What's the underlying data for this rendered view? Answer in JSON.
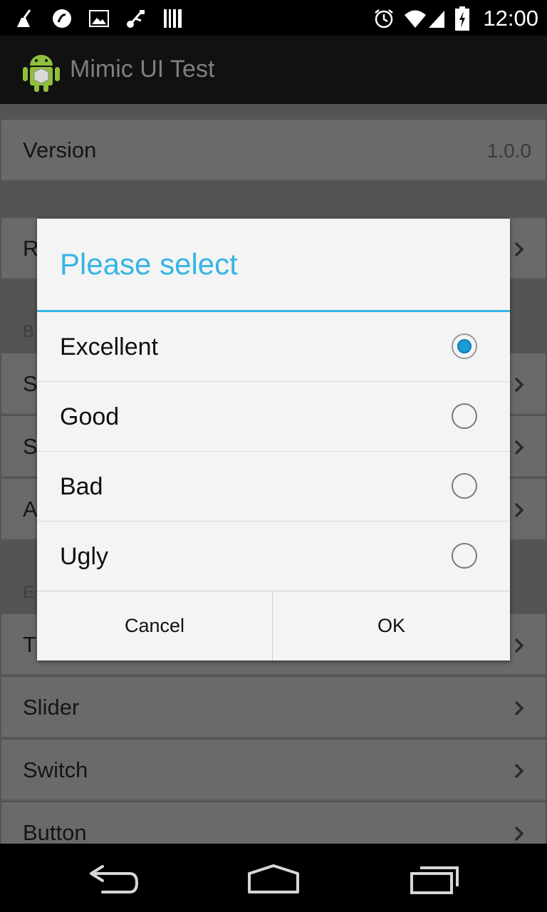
{
  "status_bar": {
    "time": "12:00",
    "left_icons": [
      "cleaner-icon",
      "sync-icon",
      "image-icon",
      "usb-icon",
      "barcode-icon"
    ],
    "right_icons": [
      "alarm-icon",
      "wifi-icon",
      "cell-signal-icon",
      "battery-icon"
    ]
  },
  "action_bar": {
    "title": "Mimic UI Test",
    "icon": "android-icon"
  },
  "background_list": {
    "rows": [
      {
        "label": "Version",
        "value": "1.0.0"
      },
      {
        "label": "R"
      },
      {
        "label": "S"
      },
      {
        "label": "S"
      },
      {
        "label": "A"
      },
      {
        "label": "T"
      },
      {
        "label": "Slider"
      },
      {
        "label": "Switch"
      },
      {
        "label": "Button"
      }
    ],
    "section_headers": [
      "B",
      "E"
    ]
  },
  "dialog": {
    "title": "Please select",
    "options": [
      {
        "label": "Excellent",
        "checked": true
      },
      {
        "label": "Good",
        "checked": false
      },
      {
        "label": "Bad",
        "checked": false
      },
      {
        "label": "Ugly",
        "checked": false
      }
    ],
    "cancel_label": "Cancel",
    "ok_label": "OK"
  },
  "colors": {
    "accent": "#35b5e5",
    "radio_selected": "#1a9ad6",
    "dialog_bg": "#f4f4f4"
  },
  "nav_bar": {
    "icons": [
      "back-icon",
      "home-icon",
      "recents-icon"
    ]
  }
}
